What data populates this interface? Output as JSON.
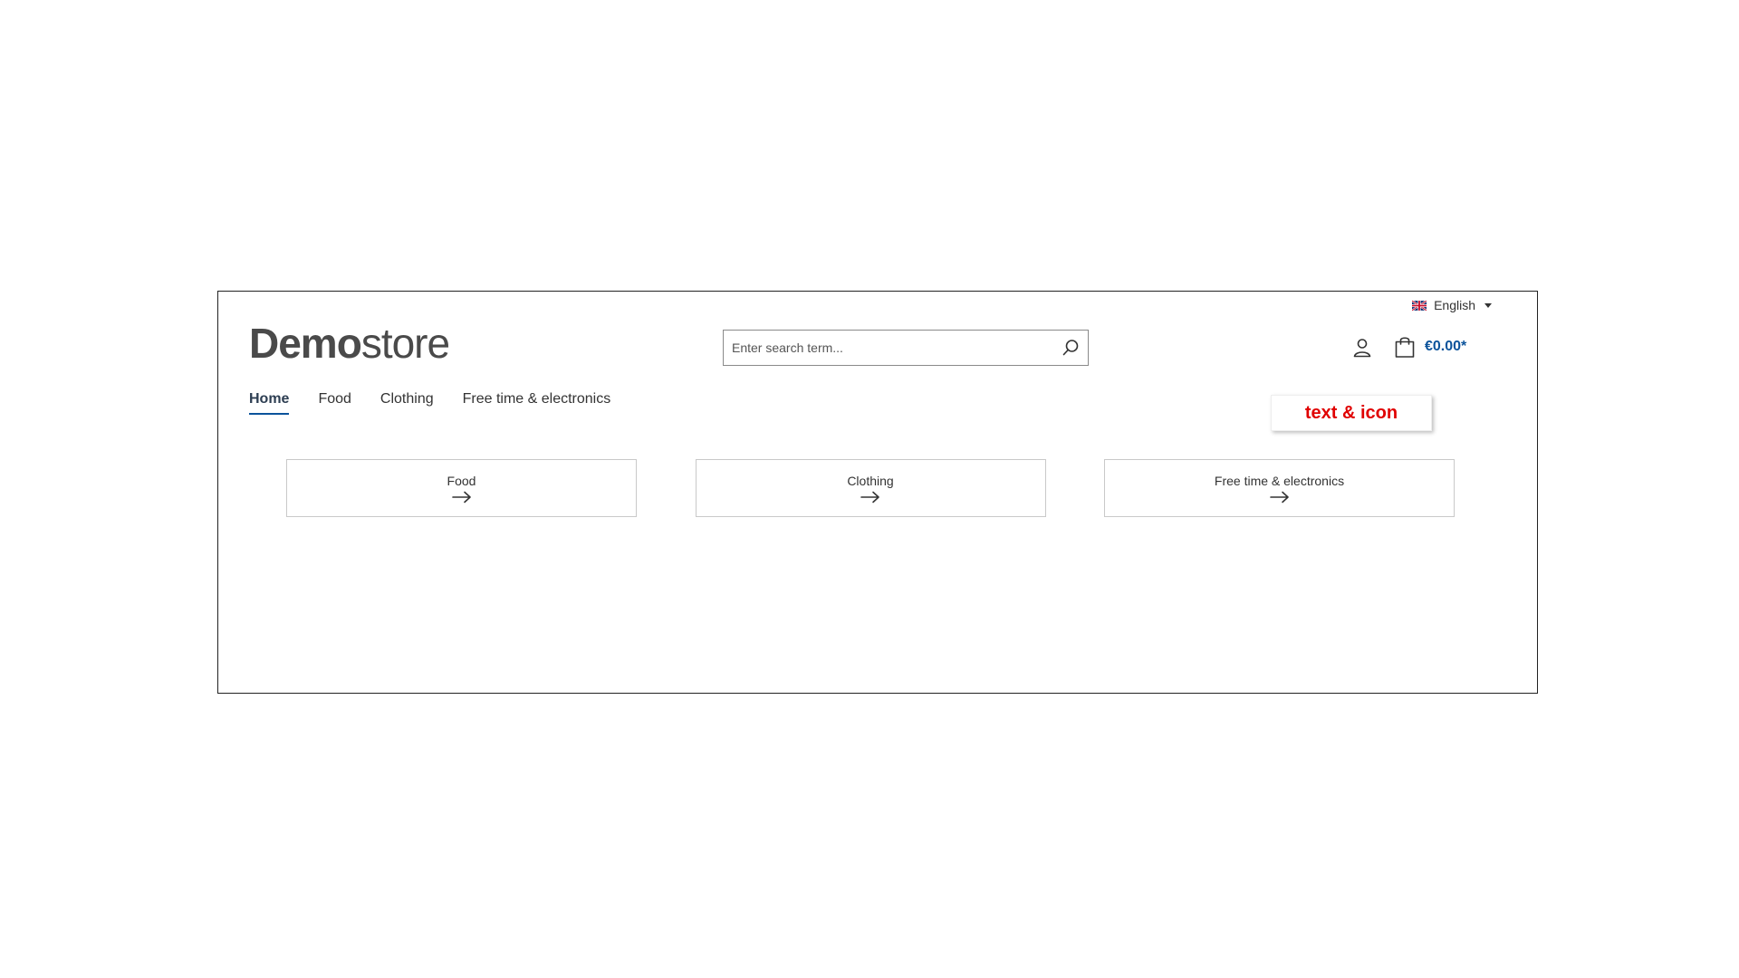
{
  "header": {
    "language": {
      "label": "English",
      "flag": "uk-flag-icon"
    },
    "logo": {
      "bold": "Demo",
      "light": "store"
    },
    "search": {
      "placeholder": "Enter search term...",
      "icon": "search-icon"
    },
    "account": {
      "icon": "user-icon"
    },
    "cart": {
      "icon": "shopping-bag-icon",
      "total": "€0.00*"
    }
  },
  "nav": {
    "items": [
      {
        "label": "Home",
        "active": true
      },
      {
        "label": "Food",
        "active": false
      },
      {
        "label": "Clothing",
        "active": false
      },
      {
        "label": "Free time & electronics",
        "active": false
      }
    ]
  },
  "annotation": {
    "label": "text & icon"
  },
  "tiles": [
    {
      "label": "Food",
      "icon": "arrow-right-icon"
    },
    {
      "label": "Clothing",
      "icon": "arrow-right-icon"
    },
    {
      "label": "Free time & electronics",
      "icon": "arrow-right-icon"
    }
  ],
  "colors": {
    "accent": "#0b539b",
    "annotation": "#e00000"
  }
}
